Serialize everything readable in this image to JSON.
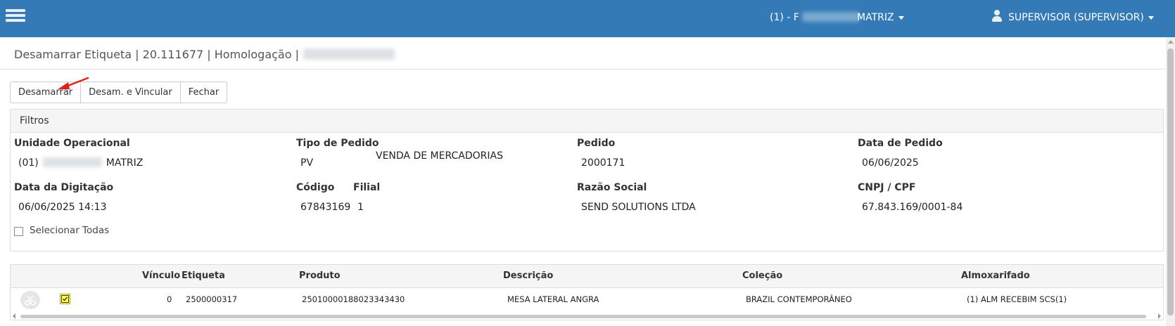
{
  "header": {
    "unit_label": "(1) - F",
    "branch": "MATRIZ",
    "user": "SUPERVISOR (SUPERVISOR)"
  },
  "page": {
    "title": "Desamarrar Etiqueta | 20.111677 | Homologação |"
  },
  "toolbar": {
    "untie_label": "Desamarrar",
    "untie_link_label": "Desam. e Vincular",
    "close_label": "Fechar"
  },
  "filters": {
    "heading": "Filtros",
    "unidade_operacional": {
      "label": "Unidade Operacional",
      "code": "(01)",
      "name": "MATRIZ"
    },
    "tipo_pedido": {
      "label": "Tipo de Pedido",
      "code": "PV",
      "description": "VENDA DE MERCADORIAS"
    },
    "pedido": {
      "label": "Pedido",
      "value": "2000171"
    },
    "data_pedido": {
      "label": "Data de Pedido",
      "value": "06/06/2025"
    },
    "data_digitacao": {
      "label": "Data da Digitação",
      "value": "06/06/2025 14:13"
    },
    "codigo": {
      "label": "Código",
      "value": "67843169"
    },
    "filial": {
      "label": "Filial",
      "value": "1"
    },
    "razao_social": {
      "label": "Razão Social",
      "value": "SEND SOLUTIONS LTDA"
    },
    "cnpj_cpf": {
      "label": "CNPJ / CPF",
      "value": "67.843.169/0001-84"
    },
    "select_all_label": "Selecionar Todas"
  },
  "grid": {
    "columns": [
      "Vínculo",
      "Etiqueta",
      "Produto",
      "Descrição",
      "Coleção",
      "Almoxarifado"
    ],
    "rows": [
      {
        "vinculo": "0",
        "etiqueta": "2500000317",
        "produto": "25010000188023343430",
        "descricao": "MESA LATERAL ANGRA",
        "colecao": "BRAZIL CONTEMPORÂNEO",
        "almoxarifado": "(1) ALM RECEBIM SCS(1)",
        "checked": true
      }
    ]
  },
  "colors": {
    "topbar": "#337ab7",
    "row_checkbox_highlight": "#ffff66",
    "annotation_arrow": "#e0201b"
  },
  "icons": {
    "menu": "hamburger-icon",
    "user": "user-icon",
    "row_action": "unlink-icon",
    "checked": "check-icon"
  }
}
